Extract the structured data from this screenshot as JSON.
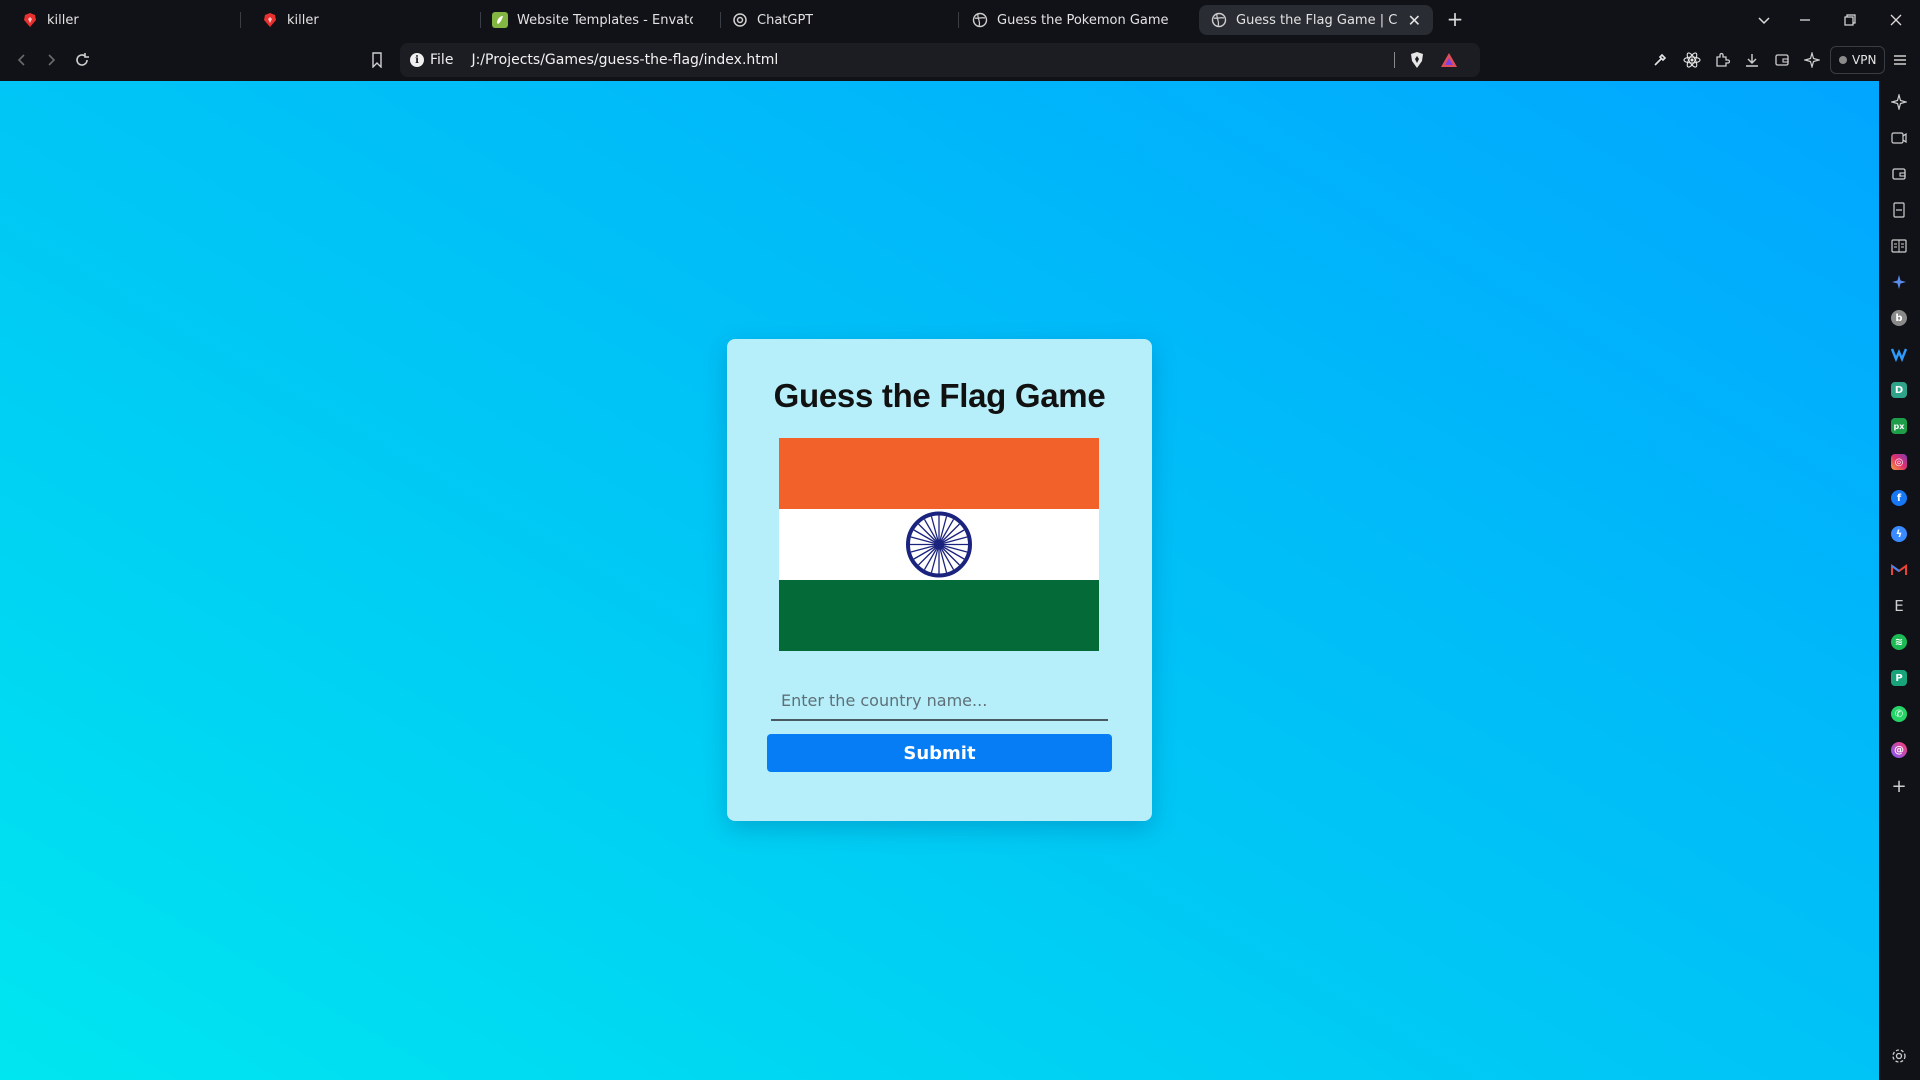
{
  "tabs": [
    {
      "title": "killer",
      "icon": "brave-lion-icon"
    },
    {
      "title": "killer",
      "icon": "brave-lion-icon"
    },
    {
      "title": "Website Templates - Envato",
      "icon": "envato-icon"
    },
    {
      "title": "ChatGPT",
      "icon": "chatgpt-icon"
    },
    {
      "title": "Guess the Pokemon Game in Vanilla",
      "icon": "globe-icon"
    },
    {
      "title": "Guess the Flag Game | Coding",
      "icon": "globe-icon",
      "active": true
    }
  ],
  "toolbar": {
    "url_scheme_label": "File",
    "url": "J:/Projects/Games/guess-the-flag/index.html",
    "vpn_label": "VPN"
  },
  "game": {
    "title": "Guess the Flag Game",
    "input_placeholder": "Enter the country name...",
    "input_value": "",
    "submit_label": "Submit",
    "flag_colors": {
      "top": "#f26129",
      "middle": "#ffffff",
      "bottom": "#046a38",
      "chakra": "#1a237e"
    }
  },
  "colors": {
    "accent": "#077df5",
    "card_bg": "#b6effa",
    "gradient_start": "#00e6f0",
    "gradient_end": "#01a6ff"
  },
  "sidebar_icons": [
    "leo-ai-icon",
    "media-icon",
    "wallet-icon",
    "bookmark-icon",
    "reading-list-icon",
    "sparkle-icon",
    "brave-icon",
    "wave-icon",
    "d-app-icon",
    "px-app-icon",
    "instagram-icon",
    "facebook-icon",
    "messenger-icon",
    "gmail-icon",
    "e-app-icon",
    "spotify-icon",
    "p-app-icon",
    "whatsapp-icon",
    "threads-icon",
    "add-icon",
    "settings-icon"
  ]
}
